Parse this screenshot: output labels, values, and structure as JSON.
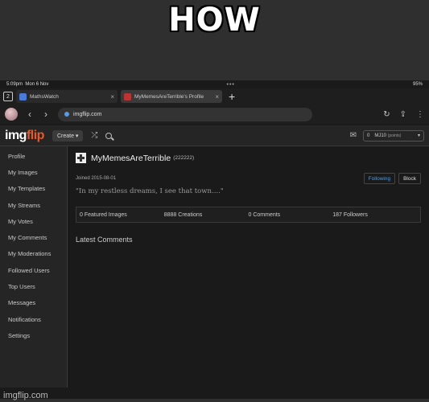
{
  "meme": {
    "caption": "HOW",
    "watermark": "imgflip.com"
  },
  "status": {
    "time": "5:09pm",
    "date": "Mon 6 Nov",
    "dots": "•••",
    "battery": "95%"
  },
  "tabs": {
    "count": "2",
    "items": [
      {
        "title": "MathsWatch",
        "close": "×"
      },
      {
        "title": "MyMemesAreTerrible's Profile",
        "close": "×"
      }
    ],
    "new_tab": "+"
  },
  "address": {
    "url": "imgflip.com",
    "back": "‹",
    "forward": "›"
  },
  "site": {
    "logo_a": "img",
    "logo_b": "flip",
    "create_label": "Create ▾",
    "shuffle_icon": "⤮",
    "mail_icon": "✉",
    "notif_count": "0",
    "username": "MJ10",
    "username_suffix": "(points)",
    "dropdown": "▾"
  },
  "sidebar": {
    "items": [
      "Profile",
      "My Images",
      "My Templates",
      "My Streams",
      "My Votes",
      "My Comments",
      "My Moderations",
      "Followed Users",
      "Top Users",
      "Messages",
      "Notifications",
      "Settings"
    ]
  },
  "profile": {
    "name": "MyMemesAreTerrible",
    "points": "(222222)",
    "joined": "Joined 2015-08-01",
    "follow_label": "Following",
    "block_label": "Block",
    "quote": "\"In my restless dreams, I see that town....\"",
    "stats": [
      "0 Featured Images",
      "8888 Creations",
      "0 Comments",
      "187 Followers"
    ],
    "latest_comments": "Latest Comments"
  }
}
